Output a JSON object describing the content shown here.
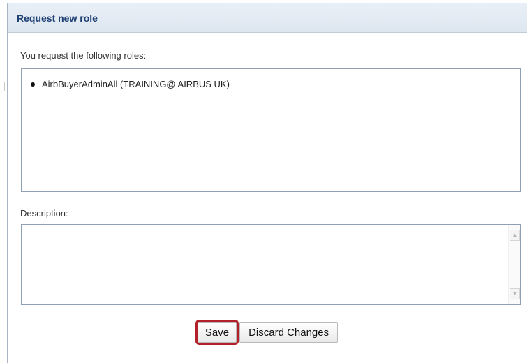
{
  "panel": {
    "title": "Request new role"
  },
  "roles": {
    "label": "You request the following roles:",
    "items": [
      "AirbBuyerAdminAll (TRAINING@ AIRBUS UK)"
    ]
  },
  "description": {
    "label": "Description:",
    "value": ""
  },
  "buttons": {
    "save_label": "Save",
    "discard_label": "Discard Changes"
  },
  "colors": {
    "highlight": "#b3202a",
    "header_title": "#1d3f73"
  }
}
